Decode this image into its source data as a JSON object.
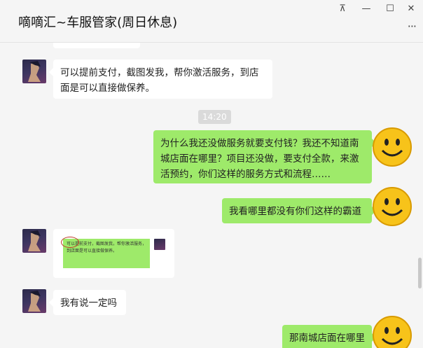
{
  "window": {
    "title": "嘀嘀汇~车服管家(周日休息)",
    "controls": {
      "pin": "⊼",
      "minimize": "—",
      "maximize": "☐",
      "close": "✕",
      "more": "···"
    }
  },
  "chat": {
    "time_divider": "14:20",
    "messages": [
      {
        "side": "left",
        "type": "text",
        "text_lines": [
          "可以提前支付，截图发我，帮你激活服务，到店",
          "面是可以直接做保养。"
        ]
      },
      {
        "side": "right",
        "type": "text",
        "text_lines": [
          "为什么我还没做服务就要支付钱？我还不知道南",
          "城店面在哪里？项目还没做，要支付全款，来激",
          "活预约，你们这样的服务方式和流程……"
        ]
      },
      {
        "side": "right",
        "type": "text",
        "text_lines": [
          "我看哪里都没有你们这样的霸道"
        ]
      },
      {
        "side": "left",
        "type": "image",
        "image_text": "可以提前支付，截图发我，帮你激活服务，到店面是可以直接做保养。"
      },
      {
        "side": "left",
        "type": "text",
        "text_lines": [
          "我有说一定吗"
        ]
      },
      {
        "side": "right",
        "type": "text",
        "text_lines": [
          "那南城店面在哪里"
        ]
      }
    ]
  },
  "colors": {
    "sent_bubble": "#9eea6a",
    "received_bubble": "#ffffff",
    "background": "#f5f5f5"
  }
}
